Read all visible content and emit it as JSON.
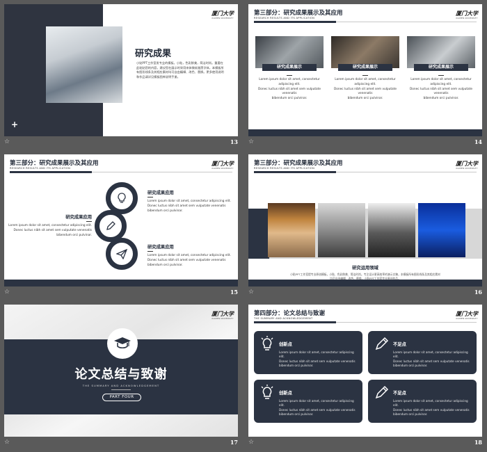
{
  "lorem": {
    "line1": "Lorem ipsum dolor sit amet, consectetur adipiscing elit.",
    "line2": "Donec luctus nibh sit amet sem vulputate venenatis",
    "line3": "bibendum orci pulvinar."
  },
  "logo": {
    "name": "厦门大学",
    "sub": "XIAMEN UNIVERSITY"
  },
  "header3": {
    "title": "第三部分：研究成果展示及其应用",
    "sub": "RESEARCH RESULTS AND ITS APPLICATION"
  },
  "header4": {
    "title": "第四部分：论文总结与致谢",
    "sub": "THE SUMMARY AND ACKNOWLEDGEMENT"
  },
  "slides": {
    "s13": {
      "number": "13",
      "title": "研究成果",
      "body": "小贴PPT工作室发专业的模板，小贴，色彩鲜美，简洁时尚。重要在此粘贴您的内容，建议您在展示时采用宋体微软雅黑字体，本模板所有图形线条及其相应素材均可自由编辑、改色、替换。更多使用说明和作品请详见模板图库说明手册。"
    },
    "s14": {
      "number": "14",
      "card_label": "研究成果展示"
    },
    "s15": {
      "number": "15",
      "item_label": "研究成果应用"
    },
    "s16": {
      "number": "16",
      "label": "研究运用领域",
      "text": "小贴PPT工作室提专业原创模板，小贴、色彩鲜美、简洁时尚。专注设计更高效率的演示文稿，本模板所有图形线条及其相应素材均可自由编辑、改色、替换，小贴PPT工作室专业原创作品。"
    },
    "s17": {
      "number": "17",
      "title": "论文总结与致谢",
      "sub": "THE SUMMARY AND ACKNOWLEDGEMENT",
      "pill": "PART FOUR"
    },
    "s18": {
      "number": "18",
      "innovation": "创新点",
      "shortcoming": "不足点"
    }
  },
  "colors": {
    "navy": "#2b3342",
    "background": "#5a5a5a"
  },
  "icons": [
    "star-icon",
    "plus-icon",
    "lightbulb-icon",
    "pencil-icon",
    "paper-plane-icon",
    "graduation-cap-icon"
  ]
}
